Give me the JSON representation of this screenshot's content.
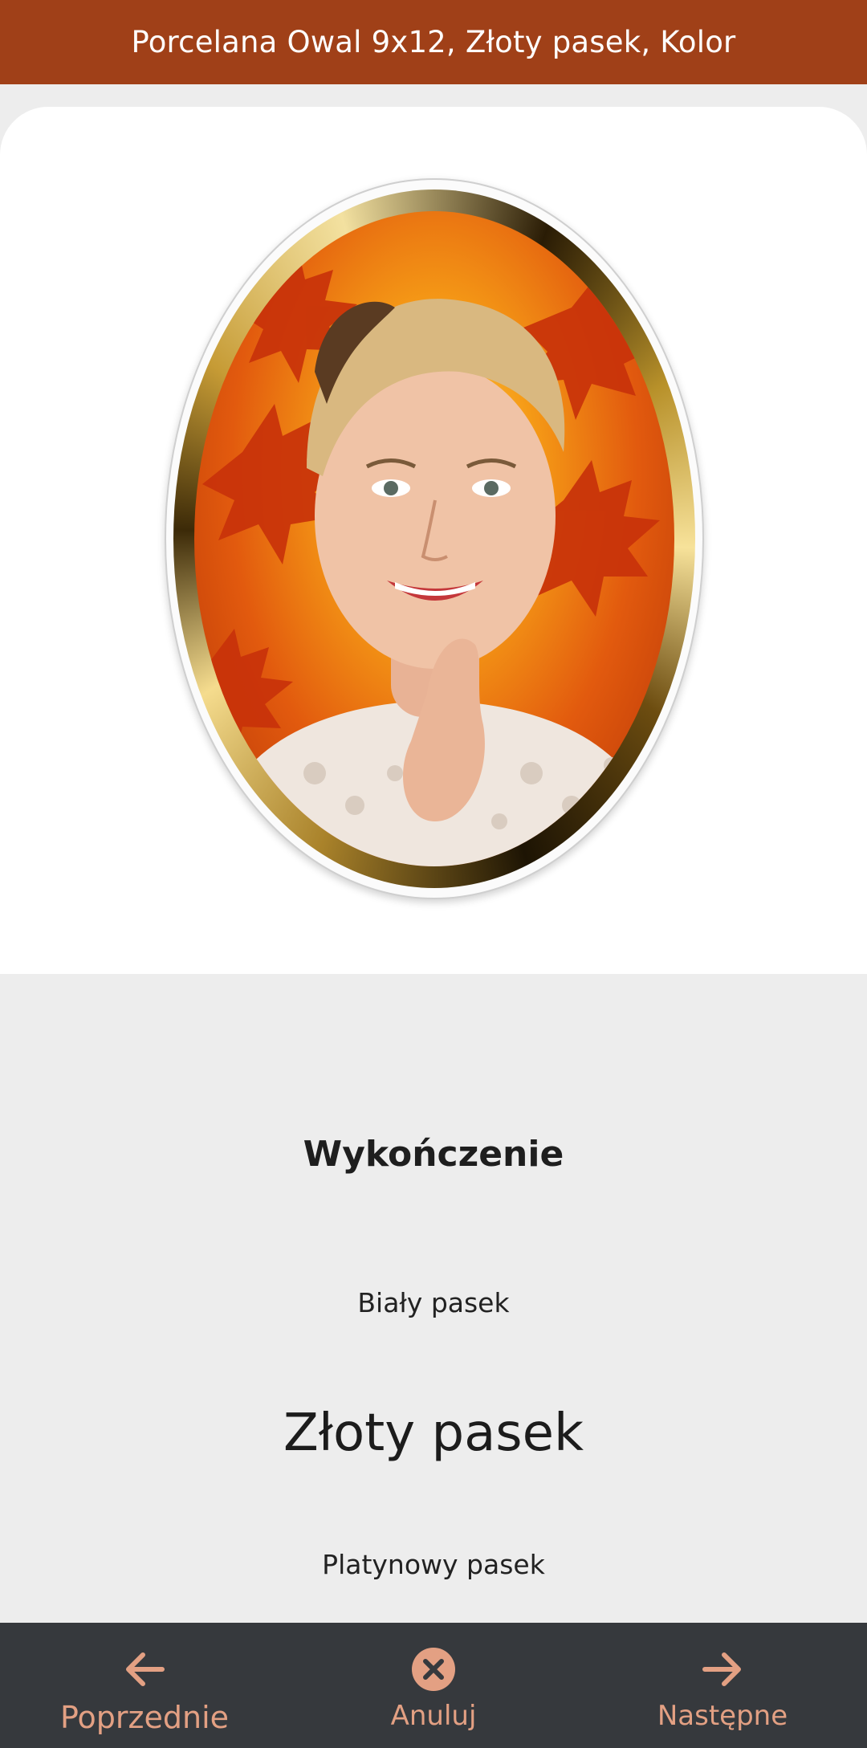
{
  "header": {
    "title": "Porcelana Owal 9x12, Złoty pasek, Kolor"
  },
  "preview": {
    "image": "oval-porcelain-photo-gold-frame"
  },
  "finish_picker": {
    "title": "Wykończenie",
    "options": [
      {
        "label": "Biały pasek",
        "selected": false
      },
      {
        "label": "Złoty pasek",
        "selected": true
      },
      {
        "label": "Platynowy pasek",
        "selected": false
      }
    ]
  },
  "bottom_nav": {
    "prev_label": "Poprzednie",
    "cancel_label": "Anuluj",
    "next_label": "Następne",
    "prev_icon": "arrow-left-icon",
    "cancel_icon": "close-circle-icon",
    "next_icon": "arrow-right-icon"
  },
  "colors": {
    "header_bg": "#a04018",
    "bottom_bar_bg": "#36393d",
    "accent": "#e3a083"
  }
}
